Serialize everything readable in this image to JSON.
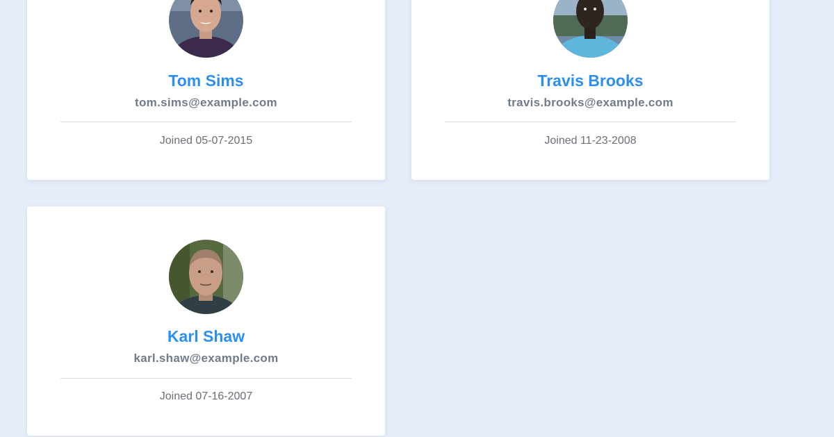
{
  "users": [
    {
      "name": "Tom Sims",
      "email": "tom.sims@example.com",
      "joined_prefix": "Joined",
      "joined_date": "05-07-2015"
    },
    {
      "name": "Travis Brooks",
      "email": "travis.brooks@example.com",
      "joined_prefix": "Joined",
      "joined_date": "11-23-2008"
    },
    {
      "name": "Karl Shaw",
      "email": "karl.shaw@example.com",
      "joined_prefix": "Joined",
      "joined_date": "07-16-2007"
    }
  ],
  "colors": {
    "background": "#e6edf9",
    "card": "#ffffff",
    "name_accent": "#2b8ff0",
    "email_text": "#707b8b",
    "joined_text": "#6b6f76",
    "divider": "#d9dde3"
  }
}
